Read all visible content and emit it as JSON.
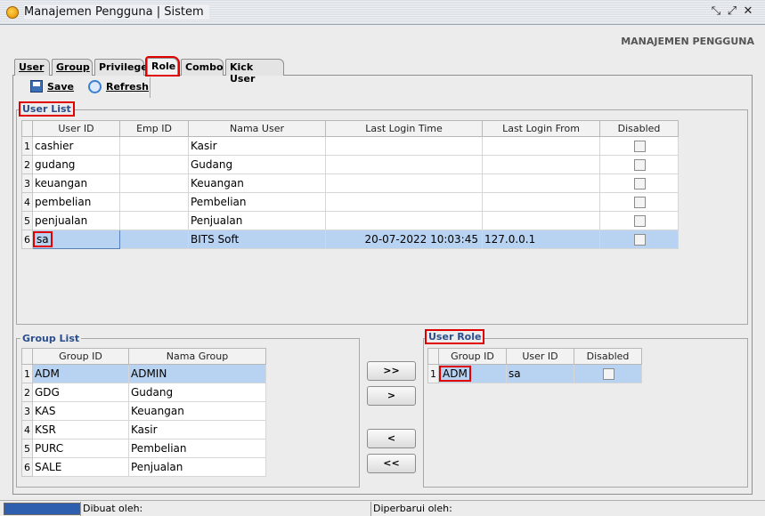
{
  "window": {
    "title": "Manajemen Pengguna | Sistem",
    "header": "MANAJEMEN PENGGUNA"
  },
  "tabs": [
    {
      "label": "User"
    },
    {
      "label": "Group"
    },
    {
      "label": "Privilege"
    },
    {
      "label": "Role",
      "active": true
    },
    {
      "label": "Combo"
    },
    {
      "label": "Kick User"
    }
  ],
  "toolbar": {
    "save_label": "Save",
    "refresh_label": "Refresh"
  },
  "user_list": {
    "label": "User List",
    "columns": [
      "User ID",
      "Emp ID",
      "Nama User",
      "Last Login Time",
      "Last Login From",
      "Disabled"
    ],
    "rows": [
      {
        "n": "1",
        "user_id": "cashier",
        "emp_id": "",
        "nama": "Kasir",
        "time": "",
        "from": "",
        "disabled": false
      },
      {
        "n": "2",
        "user_id": "gudang",
        "emp_id": "",
        "nama": "Gudang",
        "time": "",
        "from": "",
        "disabled": false
      },
      {
        "n": "3",
        "user_id": "keuangan",
        "emp_id": "",
        "nama": "Keuangan",
        "time": "",
        "from": "",
        "disabled": false
      },
      {
        "n": "4",
        "user_id": "pembelian",
        "emp_id": "",
        "nama": "Pembelian",
        "time": "",
        "from": "",
        "disabled": false
      },
      {
        "n": "5",
        "user_id": "penjualan",
        "emp_id": "",
        "nama": "Penjualan",
        "time": "",
        "from": "",
        "disabled": false
      },
      {
        "n": "6",
        "user_id": "sa",
        "emp_id": "",
        "nama": "BITS Soft",
        "time": "20-07-2022 10:03:45",
        "from": "127.0.0.1",
        "disabled": false,
        "selected": true
      }
    ]
  },
  "group_list": {
    "label": "Group List",
    "columns": [
      "Group ID",
      "Nama Group"
    ],
    "rows": [
      {
        "n": "1",
        "id": "ADM",
        "name": "ADMIN",
        "selected": true
      },
      {
        "n": "2",
        "id": "GDG",
        "name": "Gudang"
      },
      {
        "n": "3",
        "id": "KAS",
        "name": "Keuangan"
      },
      {
        "n": "4",
        "id": "KSR",
        "name": "Kasir"
      },
      {
        "n": "5",
        "id": "PURC",
        "name": "Pembelian"
      },
      {
        "n": "6",
        "id": "SALE",
        "name": "Penjualan"
      }
    ]
  },
  "user_role": {
    "label": "User Role",
    "columns": [
      "Group ID",
      "User ID",
      "Disabled"
    ],
    "rows": [
      {
        "n": "1",
        "group_id": "ADM",
        "user_id": "sa",
        "disabled": false
      }
    ]
  },
  "transfer_buttons": {
    "add_all": ">>",
    "add": ">",
    "remove": "<",
    "remove_all": "<<"
  },
  "statusbar": {
    "created_by": "Dibuat oleh:",
    "updated_by": "Diperbarui oleh:"
  }
}
